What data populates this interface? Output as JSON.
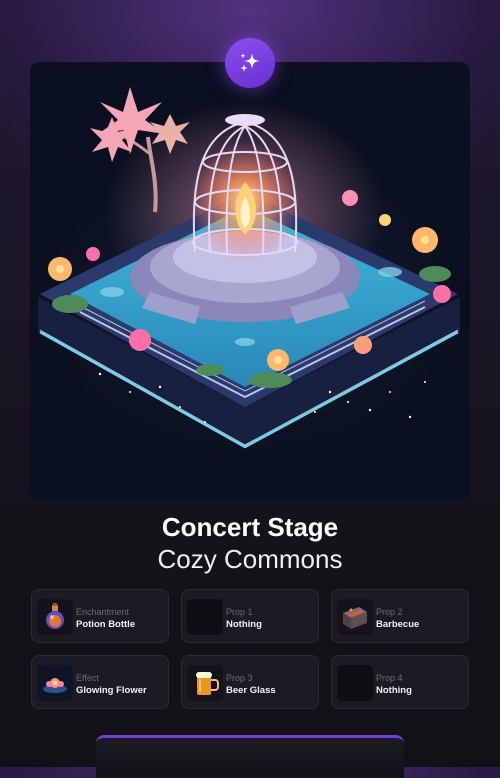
{
  "header": {
    "icon": "sparkles-icon",
    "accent": "#7b3fe4"
  },
  "item": {
    "name": "Concert Stage",
    "collection": "Cozy Commons"
  },
  "slots": [
    {
      "type": "Enchantment",
      "value": "Potion Bottle",
      "icon": "potion-bottle-icon"
    },
    {
      "type": "Prop 1",
      "value": "Nothing",
      "icon": "empty-slot-icon"
    },
    {
      "type": "Prop 2",
      "value": "Barbecue",
      "icon": "barbecue-icon"
    },
    {
      "type": "Effect",
      "value": "Glowing Flower",
      "icon": "glowing-flower-icon"
    },
    {
      "type": "Prop 3",
      "value": "Beer Glass",
      "icon": "beer-glass-icon"
    },
    {
      "type": "Prop 4",
      "value": "Nothing",
      "icon": "empty-slot-icon"
    }
  ],
  "colors": {
    "background": "#141319",
    "card": "#1c1a22",
    "muted_text": "#6d6a77",
    "water_glow": "#6ad8ff"
  }
}
